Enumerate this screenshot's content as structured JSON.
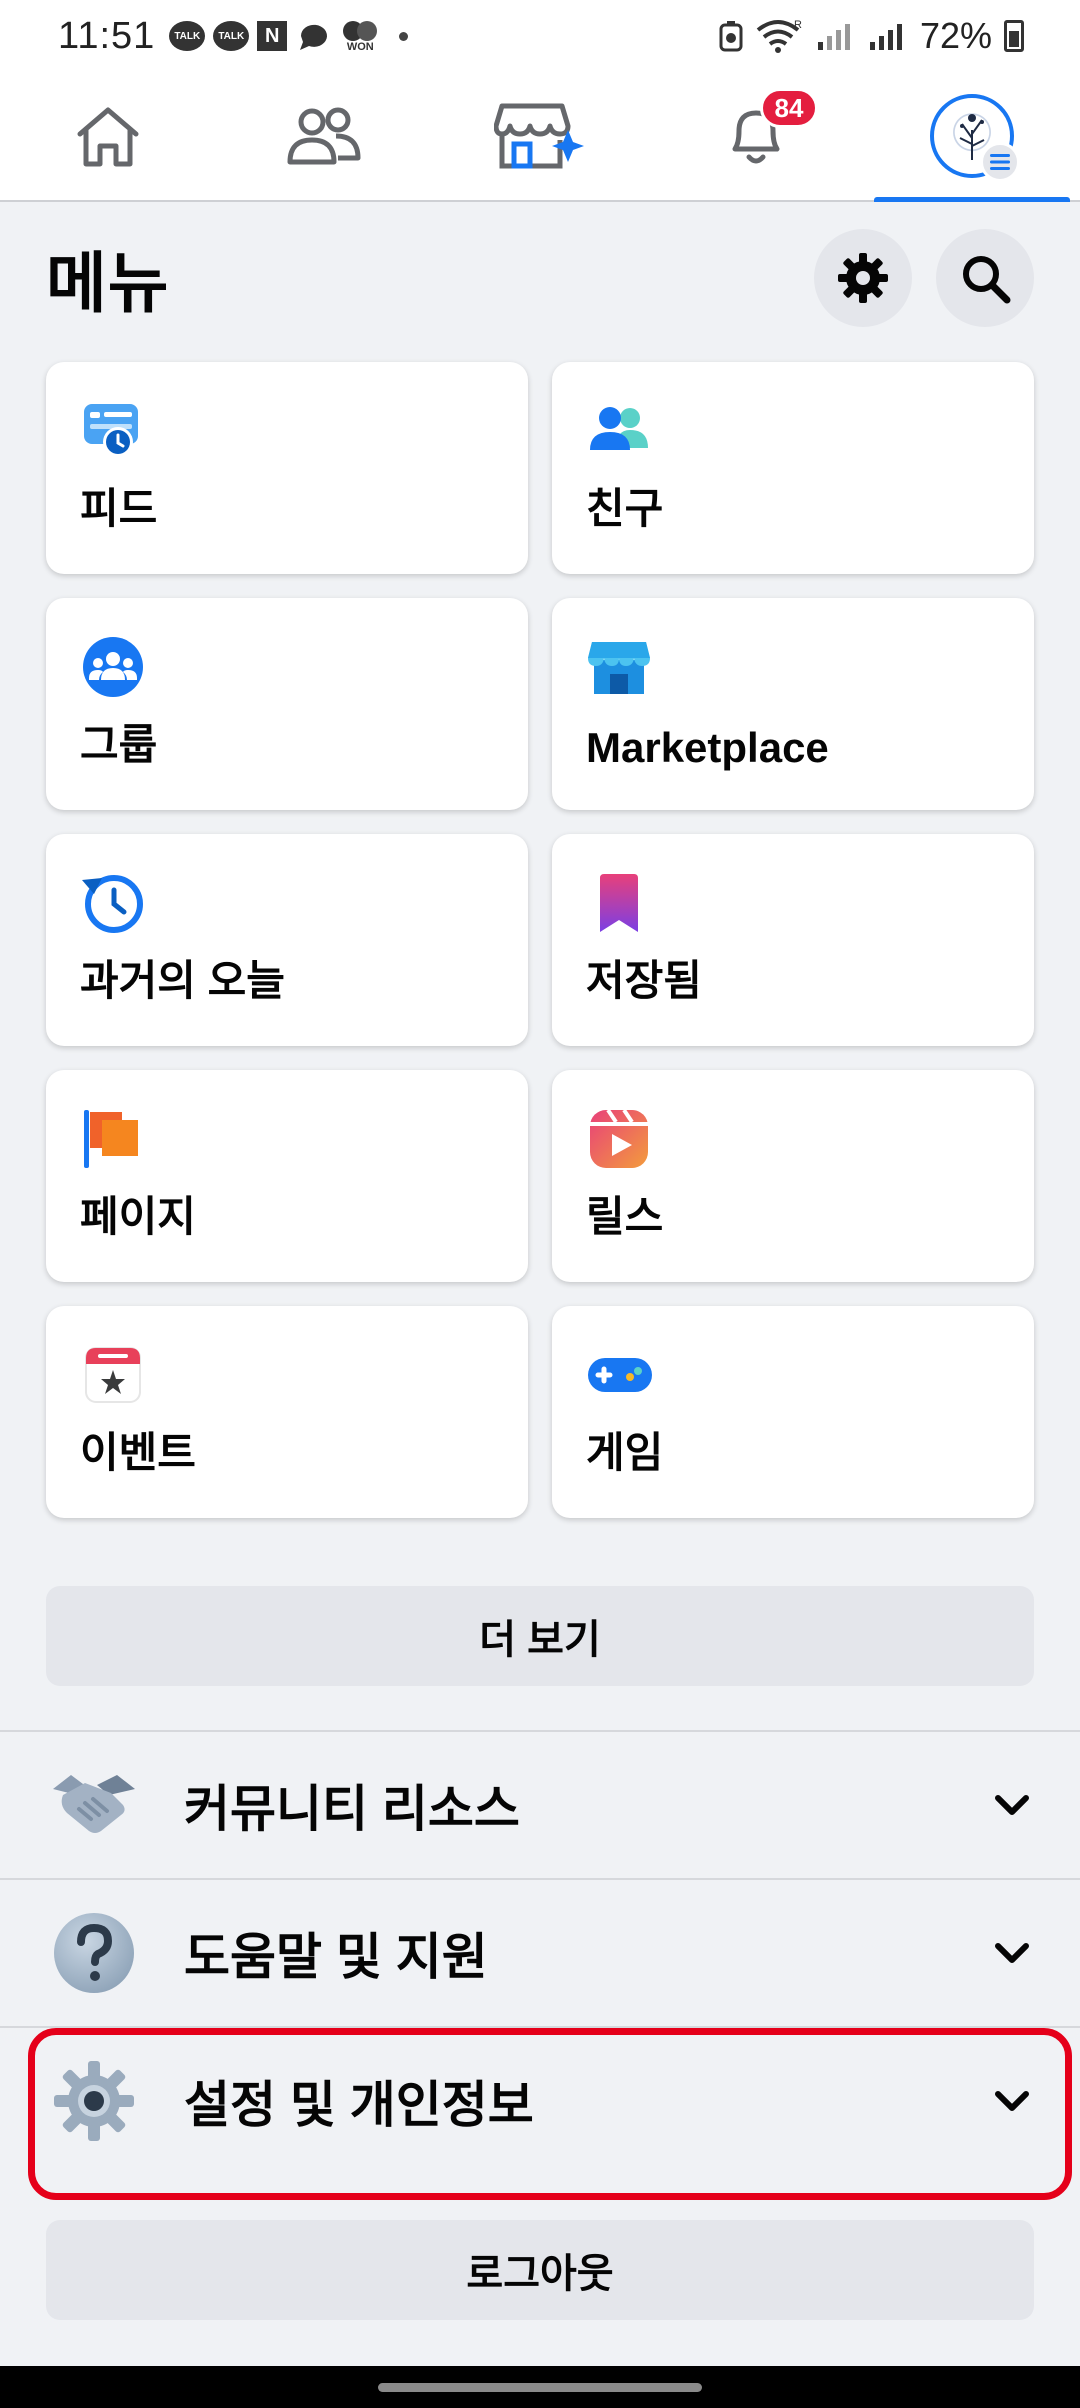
{
  "status_bar": {
    "time": "11:51",
    "notif_icons": [
      "TALK",
      "TALK"
    ],
    "n_label": "N",
    "won_label": "WON",
    "battery": "72%"
  },
  "nav": {
    "tabs": [
      "home-icon",
      "friends-icon",
      "marketplace-icon",
      "notifications-icon",
      "profile-menu"
    ],
    "notification_badge": "84"
  },
  "menu": {
    "title": "메뉴"
  },
  "shortcuts": [
    {
      "label": "피드",
      "icon": "feed-icon"
    },
    {
      "label": "친구",
      "icon": "friends-icon"
    },
    {
      "label": "그룹",
      "icon": "groups-icon"
    },
    {
      "label": "Marketplace",
      "icon": "marketplace-icon"
    },
    {
      "label": "과거의 오늘",
      "icon": "memories-icon"
    },
    {
      "label": "저장됨",
      "icon": "saved-icon"
    },
    {
      "label": "페이지",
      "icon": "pages-icon"
    },
    {
      "label": "릴스",
      "icon": "reels-icon"
    },
    {
      "label": "이벤트",
      "icon": "events-icon"
    },
    {
      "label": "게임",
      "icon": "gaming-icon"
    }
  ],
  "see_more": "더 보기",
  "sections": [
    {
      "label": "커뮤니티 리소스",
      "icon": "handshake-icon"
    },
    {
      "label": "도움말 및 지원",
      "icon": "help-icon"
    },
    {
      "label": "설정 및 개인정보",
      "icon": "settings-icon"
    }
  ],
  "logout": "로그아웃",
  "colors": {
    "accent": "#1877f2",
    "badge": "#e41e3f",
    "highlight": "#e5001a",
    "background": "#f0f2f5"
  }
}
